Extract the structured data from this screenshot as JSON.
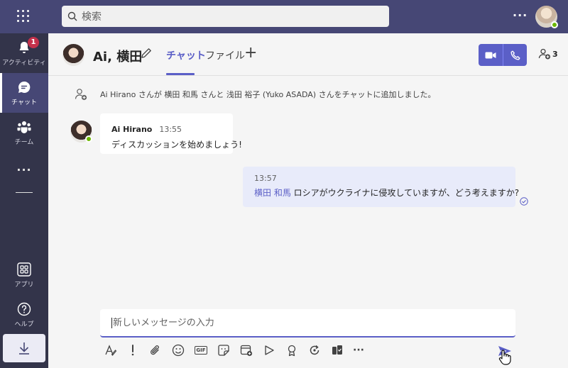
{
  "topbar": {
    "search_placeholder": "検索",
    "more_label": "···"
  },
  "rail": {
    "items": [
      {
        "label": "アクティビティ",
        "badge": "1"
      },
      {
        "label": "チャット"
      },
      {
        "label": "チーム"
      },
      {
        "label": "アプリ"
      },
      {
        "label": "ヘルプ"
      }
    ],
    "more_label": "···"
  },
  "header": {
    "chat_name": "Ai, 横田",
    "tabs": [
      {
        "label": "チャット",
        "active": true
      },
      {
        "label": "ファイル",
        "active": false
      }
    ],
    "add_tab_label": "+",
    "participant_count": "3"
  },
  "messages": {
    "system": "Ai Hirano さんが 横田 和馬 さんと 浅田 裕子 (Yuko ASADA) さんをチャットに追加しました。",
    "incoming": {
      "sender": "Ai Hirano",
      "time": "13:55",
      "text": "ディスカッションを始めましょう!"
    },
    "outgoing": {
      "time": "13:57",
      "mention": "横田 和馬",
      "text": " ロシアがウクライナに侵攻していますが、どう考えますか?"
    }
  },
  "compose": {
    "placeholder": "新しいメッセージの入力",
    "gif_label": "GIF",
    "more_label": "···"
  },
  "colors": {
    "brand": "#5b5fc7",
    "topbar": "#464775",
    "rail": "#33344a",
    "badge": "#c4314b",
    "presence": "#6bb700"
  }
}
